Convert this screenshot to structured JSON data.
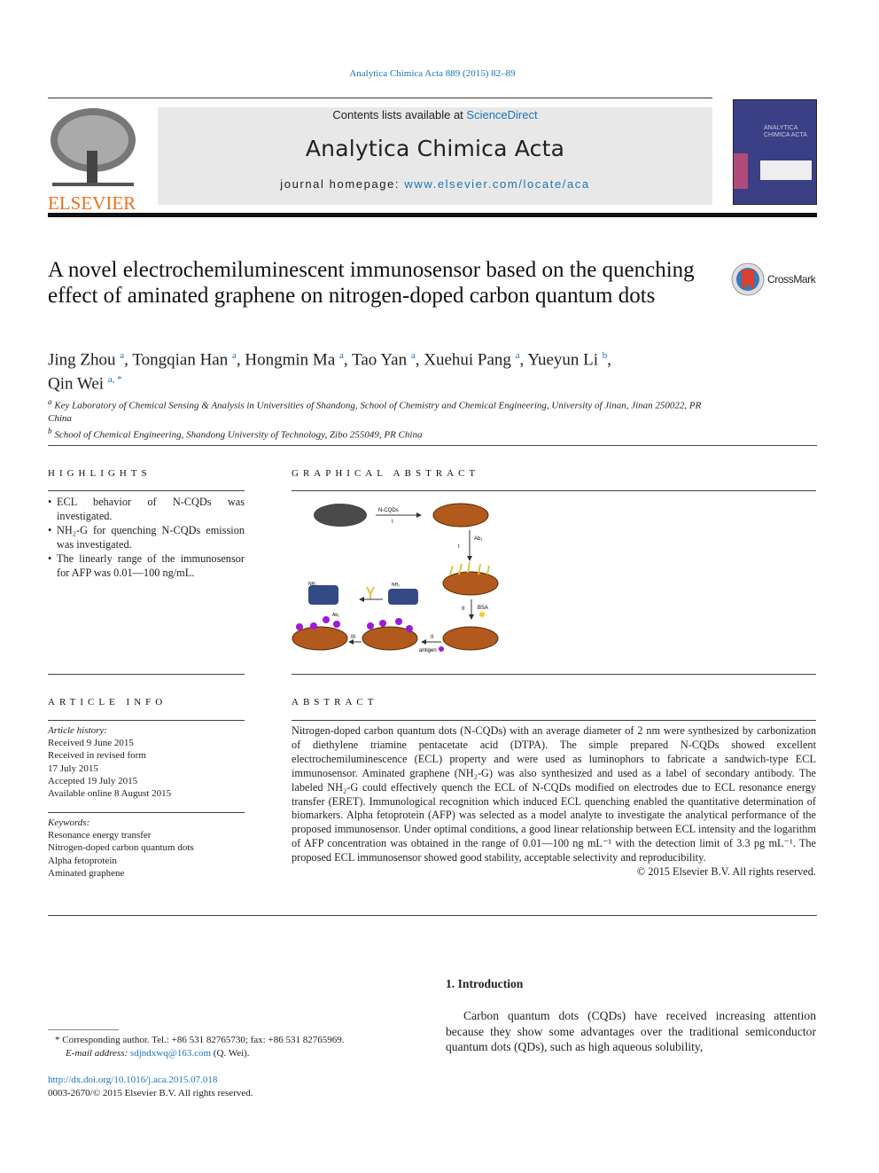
{
  "header": {
    "journal_ref": "Analytica Chimica Acta 889 (2015) 82–89",
    "contents_prefix": "Contents lists available at ",
    "contents_link": "ScienceDirect",
    "journal_title": "Analytica Chimica Acta",
    "homepage_prefix": "journal homepage: ",
    "homepage_link": "www.elsevier.com/locate/aca",
    "publisher_logo": "ELSEVIER",
    "cover_title": "ANALYTICA CHIMICA ACTA"
  },
  "article": {
    "title": "A novel electrochemiluminescent immunosensor based on the quenching effect of aminated graphene on nitrogen-doped carbon quantum dots",
    "crossmark": "CrossMark",
    "authors": [
      {
        "name": "Jing Zhou",
        "sup": "a"
      },
      {
        "name": "Tongqian Han",
        "sup": "a"
      },
      {
        "name": "Hongmin Ma",
        "sup": "a"
      },
      {
        "name": "Tao Yan",
        "sup": "a"
      },
      {
        "name": "Xuehui Pang",
        "sup": "a"
      },
      {
        "name": "Yueyun Li",
        "sup": "b"
      },
      {
        "name": "Qin Wei",
        "sup": "a, *"
      }
    ],
    "affiliations": [
      {
        "sup": "a",
        "text": "Key Laboratory of Chemical Sensing & Analysis in Universities of Shandong, School of Chemistry and Chemical Engineering, University of Jinan, Jinan 250022, PR China"
      },
      {
        "sup": "b",
        "text": "School of Chemical Engineering, Shandong University of Technology, Zibo 255049, PR China"
      }
    ]
  },
  "highlights": {
    "heading": "HIGHLIGHTS",
    "items": [
      "ECL behavior of N-CQDs was investigated.",
      "NH₂-G for quenching N-CQDs emission was investigated.",
      "The linearly range of the immunosensor for AFP was 0.01—100 ng/mL."
    ]
  },
  "graphical_abstract": {
    "heading": "GRAPHICAL ABSTRACT",
    "labels": {
      "ncqds": "N-CQDs",
      "step_i": "I",
      "ab1": "Ab₁",
      "step_ii_a": "II",
      "bsa": "BSA",
      "step_ii_b": "II",
      "antigen": "antigen",
      "step_iii": "III",
      "ab2": "Ab₂",
      "nh2": "NH₂"
    }
  },
  "article_info": {
    "heading": "ARTICLE INFO",
    "history_label": "Article history:",
    "history": [
      "Received 9 June 2015",
      "Received in revised form",
      "17 July 2015",
      "Accepted 19 July 2015",
      "Available online 8 August 2015"
    ],
    "keywords_label": "Keywords:",
    "keywords": [
      "Resonance energy transfer",
      "Nitrogen-doped carbon quantum dots",
      "Alpha fetoprotein",
      "Aminated graphene"
    ]
  },
  "abstract": {
    "heading": "ABSTRACT",
    "text": "Nitrogen-doped carbon quantum dots (N-CQDs) with an average diameter of 2 nm were synthesized by carbonization of diethylene triamine pentacetate acid (DTPA). The simple prepared N-CQDs showed excellent electrochemiluminescence (ECL) property and were used as luminophors to fabricate a sandwich-type ECL immunosensor. Aminated graphene (NH₂-G) was also synthesized and used as a label of secondary antibody. The labeled NH₂-G could effectively quench the ECL of N-CQDs modified on electrodes due to ECL resonance energy transfer (ERET). Immunological recognition which induced ECL quenching enabled the quantitative determination of biomarkers. Alpha fetoprotein (AFP) was selected as a model analyte to investigate the analytical performance of the proposed immunosensor. Under optimal conditions, a good linear relationship between ECL intensity and the logarithm of AFP concentration was obtained in the range of 0.01—100 ng mL⁻¹ with the detection limit of 3.3 pg mL⁻¹. The proposed ECL immunosensor showed good stability, acceptable selectivity and reproducibility.",
    "copyright": "© 2015 Elsevier B.V. All rights reserved."
  },
  "intro": {
    "heading": "1.  Introduction",
    "text": "Carbon quantum dots (CQDs) have received increasing attention because they show some advantages over the traditional semiconductor quantum dots (QDs), such as high aqueous solubility,"
  },
  "footnote": {
    "corresponding": "* Corresponding author. Tel.: +86 531 82765730; fax: +86 531 82765969.",
    "email_label": "E-mail address: ",
    "email": "sdjndxwq@163.com",
    "email_suffix": " (Q. Wei).",
    "doi": "http://dx.doi.org/10.1016/j.aca.2015.07.018",
    "issn": "0003-2670/© 2015 Elsevier B.V. All rights reserved."
  },
  "colors": {
    "link": "#1a75b8",
    "elsevier_orange": "#e9711c",
    "banner_bg": "#e8e8e8"
  }
}
